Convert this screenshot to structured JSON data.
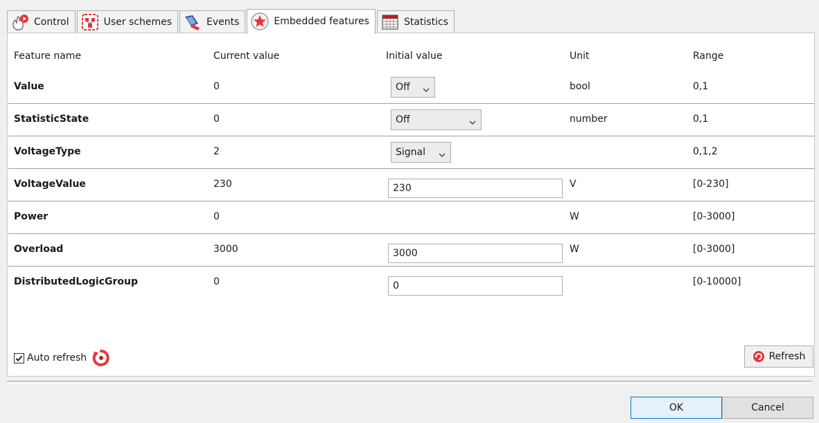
{
  "tabs": [
    {
      "label": "Control",
      "icon": "control-hand-icon"
    },
    {
      "label": "User schemes",
      "icon": "user-schemes-icon"
    },
    {
      "label": "Events",
      "icon": "events-icon"
    },
    {
      "label": "Embedded features",
      "icon": "star-icon",
      "active": true
    },
    {
      "label": "Statistics",
      "icon": "statistics-table-icon"
    }
  ],
  "table": {
    "headers": {
      "feature_name": "Feature name",
      "current_value": "Current value",
      "initial_value": "Initial value",
      "unit": "Unit",
      "range": "Range"
    },
    "rows": [
      {
        "name": "Value",
        "current": "0",
        "initial": "Off",
        "initial_type": "select",
        "unit": "bool",
        "range": "0,1"
      },
      {
        "name": "StatisticState",
        "current": "0",
        "initial": "Off",
        "initial_type": "select",
        "unit": "number",
        "range": "0,1"
      },
      {
        "name": "VoltageType",
        "current": "2",
        "initial": "Signal",
        "initial_type": "select",
        "unit": "",
        "range": "0,1,2"
      },
      {
        "name": "VoltageValue",
        "current": "230",
        "initial": "230",
        "initial_type": "text",
        "unit": "V",
        "range": "[0-230]"
      },
      {
        "name": "Power",
        "current": "0",
        "initial": "",
        "initial_type": "none",
        "unit": "W",
        "range": "[0-3000]"
      },
      {
        "name": "Overload",
        "current": "3000",
        "initial": "3000",
        "initial_type": "text",
        "unit": "W",
        "range": "[0-3000]"
      },
      {
        "name": "DistributedLogicGroup",
        "current": "0",
        "initial": "0",
        "initial_type": "text",
        "unit": "",
        "range": "[0-10000]"
      }
    ]
  },
  "auto_refresh": {
    "label": "Auto refresh",
    "checked": true
  },
  "refresh_button": {
    "label": "Refresh"
  },
  "dialog": {
    "ok_label": "OK",
    "cancel_label": "Cancel"
  },
  "colors": {
    "accent_red": "#e8353a",
    "ok_border": "#0078d7"
  }
}
